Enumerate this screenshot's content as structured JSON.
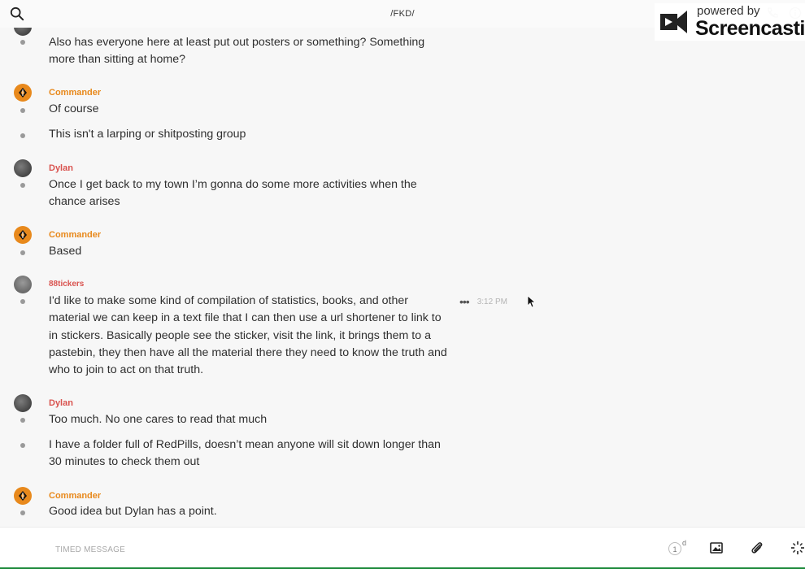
{
  "header": {
    "channel_title": "/FKD/"
  },
  "watermark": {
    "powered_text": "powered by",
    "brand_text": "Screencastify"
  },
  "messages": [
    {
      "author": "",
      "lines": [
        "Also has everyone here at least put out posters or something? Something more than sitting at home?"
      ]
    },
    {
      "author": "Commander",
      "lines": [
        "Of course",
        "This isn't a larping or shitposting group"
      ]
    },
    {
      "author": "Dylan",
      "lines": [
        "Once I get back to my town I’m gonna do some more activities when the chance arises"
      ]
    },
    {
      "author": "Commander",
      "lines": [
        "Based"
      ]
    },
    {
      "author": "88tickers",
      "lines": [
        "I'd like to make some kind of compilation of statistics, books, and other material we can keep in a text file that I can then use a url shortener to link to in stickers. Basically people see the sticker, visit the link, it brings them to a pastebin, they then have all the material there they need to know the truth and who to join to act on that truth."
      ],
      "time": "3:12 PM"
    },
    {
      "author": "Dylan",
      "lines": [
        "Too much. No one cares to read that much",
        "I have a folder full of RedPills, doesn’t mean anyone will sit down longer than 30 minutes to check them out"
      ]
    },
    {
      "author": "Commander",
      "lines": [
        "Good idea but Dylan has a point."
      ]
    }
  ],
  "composer": {
    "placeholder": "TIMED MESSAGE",
    "timer_value": "1",
    "timer_unit": "d"
  },
  "colors": {
    "commander": "#e8891c",
    "red_author": "#d9534f",
    "status_bar": "#1c8a3a"
  },
  "icons": [
    "search-icon",
    "phone-icon",
    "info-icon",
    "more-icon",
    "image-icon",
    "paperclip-icon",
    "sparkle-icon",
    "screencastify-logo-icon"
  ]
}
